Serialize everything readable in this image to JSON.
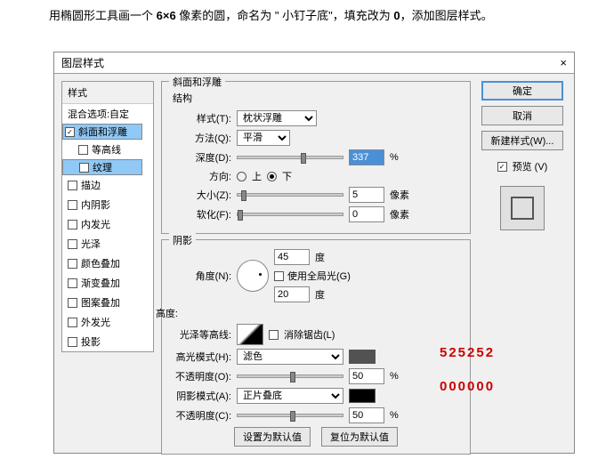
{
  "instruction_parts": {
    "pre": "用椭圆形工具画一个 ",
    "dim": "6×6",
    "mid1": " 像素的圆，命名为 \" 小钉子底\"，填充改为 ",
    "zero": "0",
    "tail": "，添加图层样式。"
  },
  "dialog": {
    "title": "图层样式",
    "close": "×"
  },
  "side_header": "样式",
  "blend_header": "混合选项:自定",
  "styles": [
    {
      "label": "斜面和浮雕",
      "checked": true,
      "sel": true
    },
    {
      "label": "等高线",
      "checked": false,
      "sub": true
    },
    {
      "label": "纹理",
      "checked": false,
      "sub": true,
      "sel": true
    },
    {
      "label": "描边",
      "checked": false
    },
    {
      "label": "内阴影",
      "checked": false
    },
    {
      "label": "内发光",
      "checked": false
    },
    {
      "label": "光泽",
      "checked": false
    },
    {
      "label": "颜色叠加",
      "checked": false
    },
    {
      "label": "渐变叠加",
      "checked": false
    },
    {
      "label": "图案叠加",
      "checked": false
    },
    {
      "label": "外发光",
      "checked": false
    },
    {
      "label": "投影",
      "checked": false
    }
  ],
  "bevel": {
    "group": "斜面和浮雕",
    "structure": "结构",
    "style_label": "样式(T):",
    "style_val": "枕状浮雕",
    "technique_label": "方法(Q):",
    "technique_val": "平滑",
    "depth_label": "深度(D):",
    "depth_val": "337",
    "pct": "%",
    "dir_label": "方向:",
    "up": "上",
    "down": "下",
    "size_label": "大小(Z):",
    "size_val": "5",
    "px": "像素",
    "soften_label": "软化(F):",
    "soften_val": "0",
    "shading": "阴影",
    "angle_label": "角度(N):",
    "angle_val": "45",
    "deg": "度",
    "global": "使用全局光(G)",
    "alt_label": "高度:",
    "alt_val": "20",
    "gloss_label": "光泽等高线:",
    "anti": "消除锯齿(L)",
    "hl_mode_label": "高光模式(H):",
    "hl_mode_val": "滤色",
    "hl_op_label": "不透明度(O):",
    "hl_op_val": "50",
    "sh_mode_label": "阴影模式(A):",
    "sh_mode_val": "正片叠底",
    "sh_op_label": "不透明度(C):",
    "sh_op_val": "50",
    "hl_color": "#525252",
    "sh_color": "#000000"
  },
  "footer": {
    "default": "设置为默认值",
    "reset": "复位为默认值"
  },
  "right": {
    "ok": "确定",
    "cancel": "取消",
    "newstyle": "新建样式(W)...",
    "preview": "预览 (V)"
  },
  "annotations": {
    "hl": "525252",
    "sh": "000000"
  }
}
